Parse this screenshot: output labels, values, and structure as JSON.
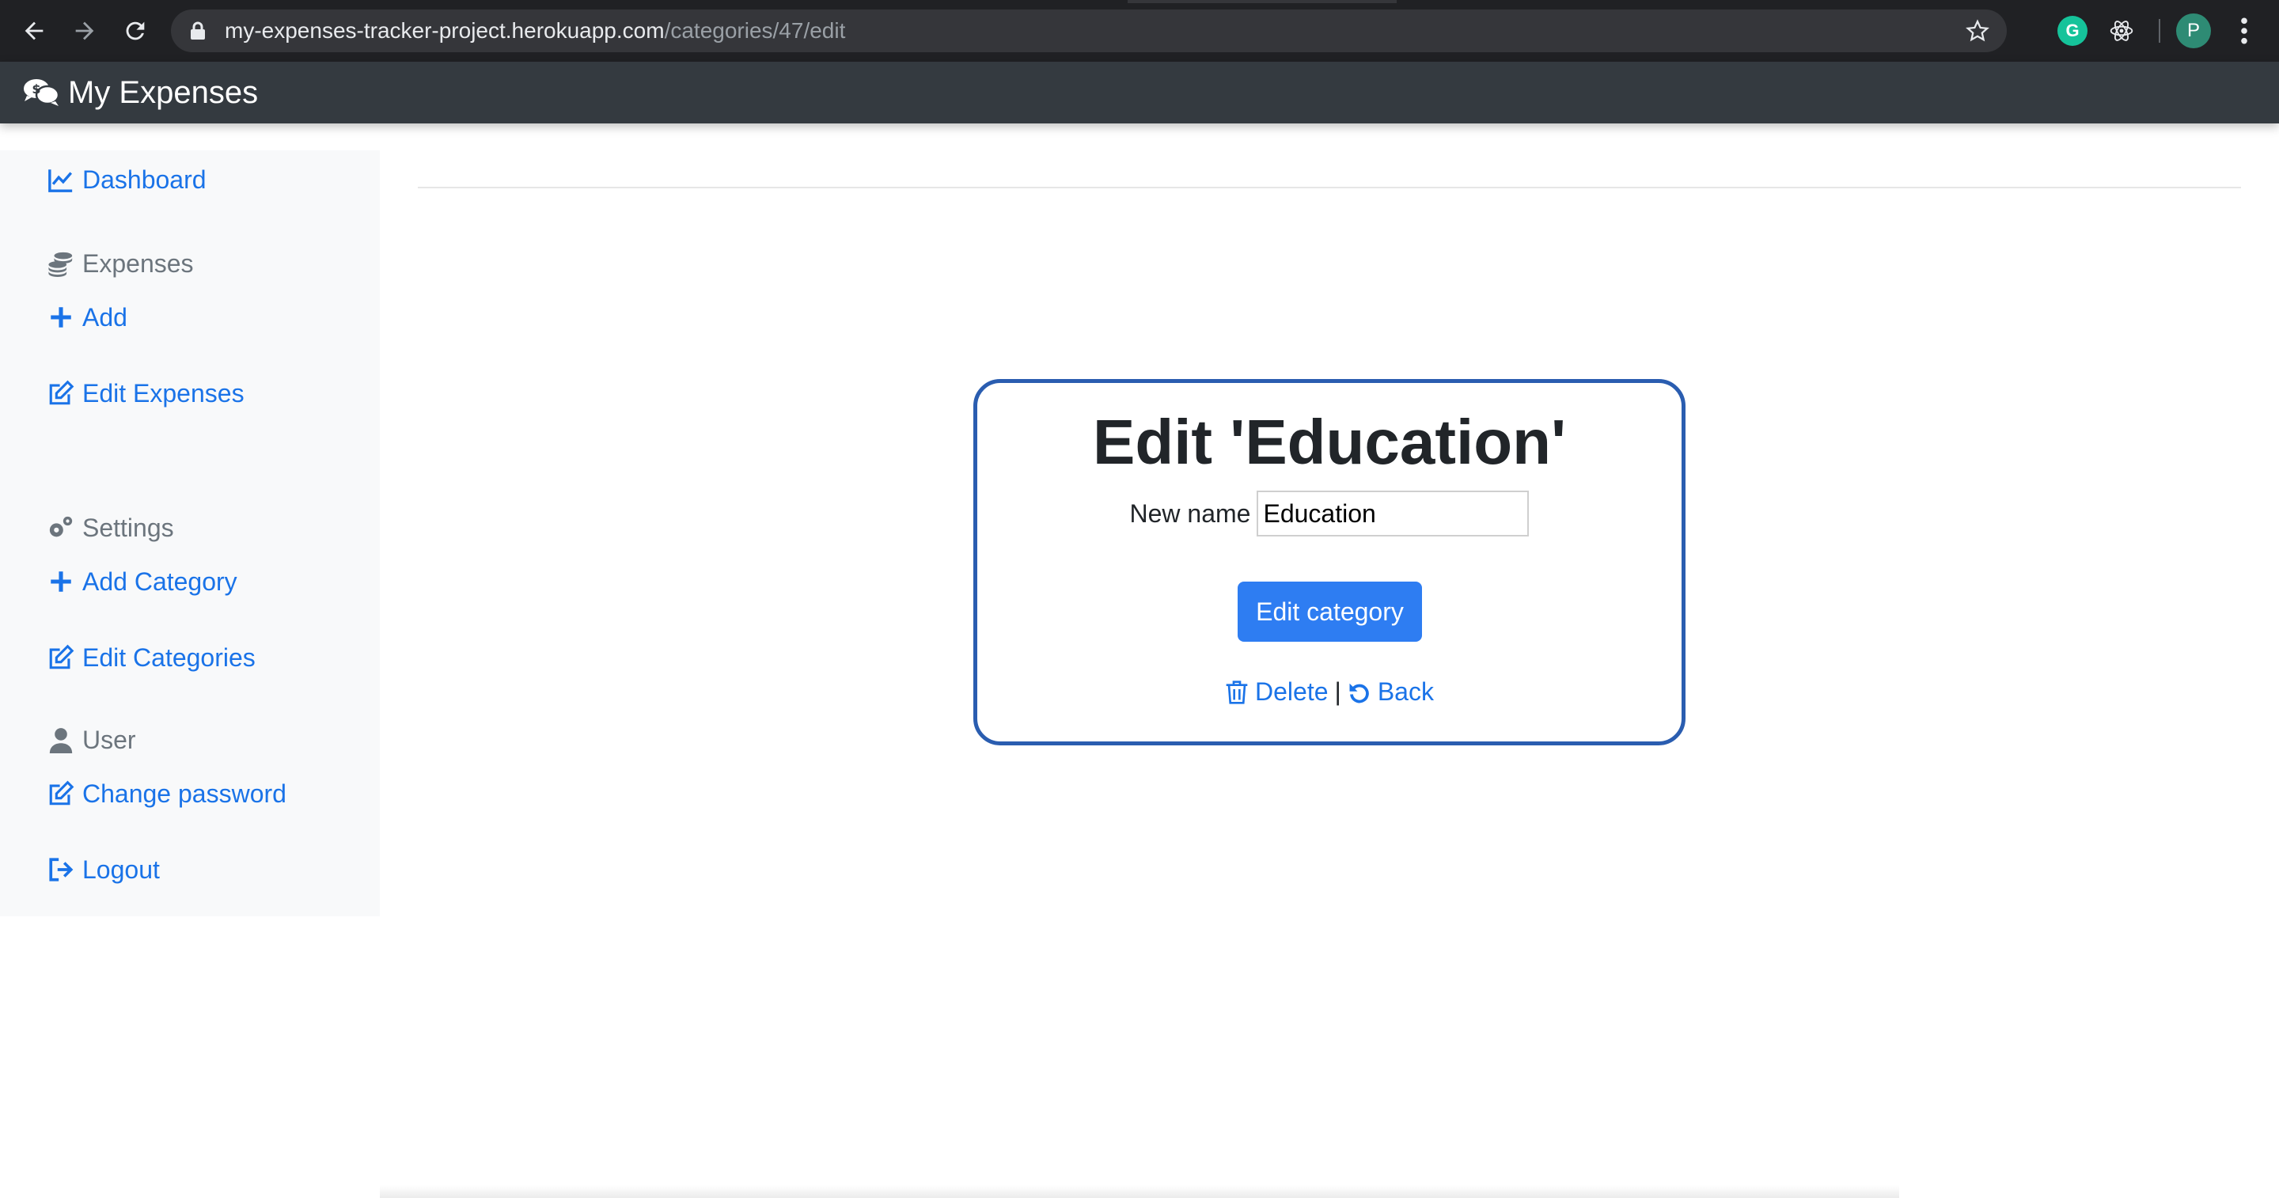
{
  "browser": {
    "url_host": "my-expenses-tracker-project.herokuapp.com",
    "url_path": "/categories/47/edit",
    "extensions": [
      {
        "name": "grammarly-icon",
        "label": "G"
      },
      {
        "name": "react-devtools-icon"
      }
    ],
    "profile_initial": "P",
    "icons": [
      "back-icon",
      "forward-icon",
      "reload-icon",
      "lock-icon",
      "star-icon",
      "more-icon"
    ]
  },
  "navbar": {
    "brand": "My Expenses",
    "brand_icon": "money-chat-icon"
  },
  "sidebar": {
    "dashboard": "Dashboard",
    "expenses_heading": "Expenses",
    "add": "Add",
    "edit_expenses": "Edit Expenses",
    "settings_heading": "Settings",
    "add_category": "Add Category",
    "edit_categories": "Edit Categories",
    "user_heading": "User",
    "change_password": "Change password",
    "logout": "Logout"
  },
  "card": {
    "title": "Edit 'Education'",
    "new_name_label": "New name",
    "new_name_value": "Education",
    "submit_label": "Edit category",
    "delete_label": "Delete",
    "separator": "|",
    "back_label": "Back"
  },
  "colors": {
    "link": "#1a73e8",
    "primary_button": "#2e7df2",
    "card_border": "#2a5db0",
    "navbar": "#343a40",
    "sidebar_bg": "#f8f9fa"
  }
}
